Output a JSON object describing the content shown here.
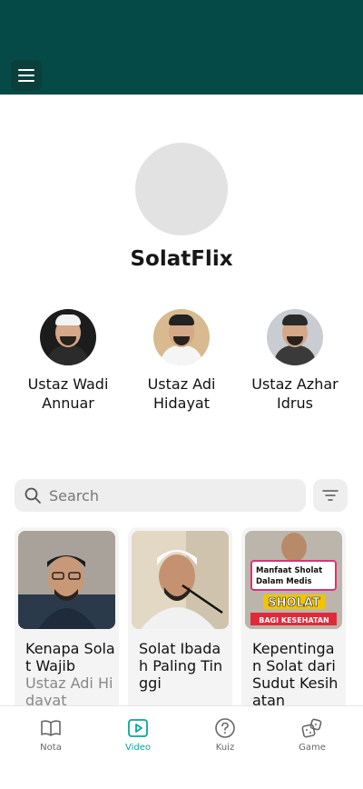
{
  "header": {
    "menu_icon": "hamburger-menu-icon",
    "background": "#064a47"
  },
  "profile": {
    "title": "SolatFlix"
  },
  "speakers": [
    {
      "name": "Ustaz Wadi Annuar"
    },
    {
      "name": "Ustaz Adi Hidayat"
    },
    {
      "name": "Ustaz Azhar Idrus"
    }
  ],
  "search": {
    "placeholder": "Search",
    "icon": "search-icon",
    "filter_icon": "filter-icon"
  },
  "videos": [
    {
      "title": "Kenapa Solat Wajib",
      "speaker": "Ustaz Adi Hidayat"
    },
    {
      "title": "Solat Ibadah Paling Tinggi",
      "speaker": ""
    },
    {
      "title": "Kepentingan Solat dari Sudut Kesihatan",
      "speaker": "",
      "thumb_text": {
        "line1": "Manfaat Sholat",
        "line2": "Dalam Medis",
        "banner": "SHOLAT",
        "sub": "BAGI KESEHATAN"
      }
    }
  ],
  "nav": {
    "items": [
      {
        "label": "Nota",
        "icon": "book-icon"
      },
      {
        "label": "Video",
        "icon": "play-icon",
        "active": true
      },
      {
        "label": "Kuiz",
        "icon": "question-icon"
      },
      {
        "label": "Game",
        "icon": "dice-icon"
      }
    ],
    "active_color": "#0aa59c"
  }
}
